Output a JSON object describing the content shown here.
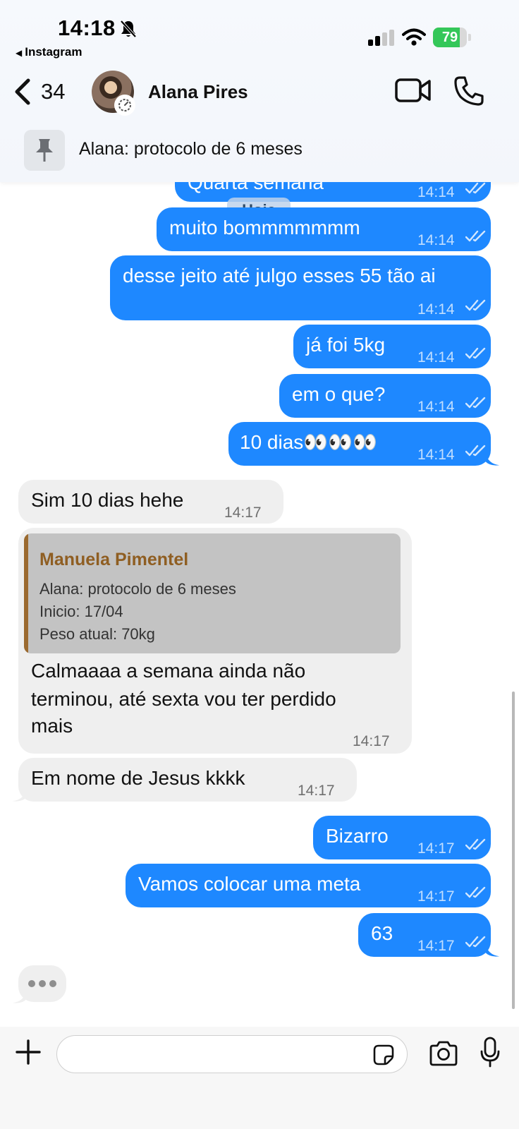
{
  "status_bar": {
    "time": "14:18",
    "back_app": "Instagram",
    "battery": "79",
    "battery_level": 0.79
  },
  "header": {
    "unread_count": "34",
    "contact_name": "Alana Pires",
    "pinned_message": "Alana: protocolo de 6 meses"
  },
  "chat": {
    "date_separator": "Hoje",
    "partial_message": {
      "text": "Quarta semana",
      "time": "14:14"
    },
    "messages": [
      {
        "direction": "out",
        "text": "muito bommmmmmm",
        "time": "14:14",
        "status": "read"
      },
      {
        "direction": "out",
        "text": "desse jeito até julgo esses 55 tão ai",
        "time": "14:14",
        "status": "read"
      },
      {
        "direction": "out",
        "text": "já foi 5kg",
        "time": "14:14",
        "status": "read"
      },
      {
        "direction": "out",
        "text": "em o que?",
        "time": "14:14",
        "status": "read"
      },
      {
        "direction": "out",
        "text": "10 dias👀👀👀",
        "time": "14:14",
        "status": "read"
      },
      {
        "direction": "in",
        "text": "Sim 10 dias hehe",
        "time": "14:17"
      },
      {
        "direction": "in",
        "quote": {
          "author": "Manuela Pimentel",
          "lines": [
            "Alana: protocolo de 6 meses",
            "Inicio: 17/04",
            "Peso atual: 70kg"
          ]
        },
        "lines": [
          "Calmaaaa a semana ainda não",
          "terminou, até sexta vou ter perdido",
          "mais"
        ],
        "time": "14:17"
      },
      {
        "direction": "in",
        "text": "Em nome de Jesus kkkk",
        "time": "14:17"
      },
      {
        "direction": "out",
        "text": "Bizarro",
        "time": "14:17",
        "status": "read"
      },
      {
        "direction": "out",
        "text": "Vamos colocar uma meta",
        "time": "14:17",
        "status": "read"
      },
      {
        "direction": "out",
        "text": "63",
        "time": "14:17",
        "status": "read"
      }
    ],
    "typing_indicator": true
  },
  "composer": {
    "placeholder": ""
  },
  "colors": {
    "outgoing_bubble": "#1e88ff",
    "incoming_bubble": "#efefef",
    "quote_author": "#8f5e22",
    "battery_green": "#34c759"
  },
  "icons": [
    "bell-slash-icon",
    "signal-icon",
    "wifi-icon",
    "chevron-left-icon",
    "video-camera-icon",
    "phone-icon",
    "pin-icon",
    "read-checks-icon",
    "plus-icon",
    "sticker-icon",
    "camera-icon",
    "microphone-icon"
  ]
}
